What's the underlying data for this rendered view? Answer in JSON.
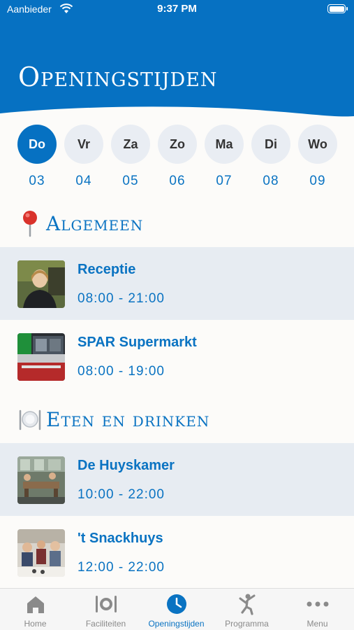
{
  "status_bar": {
    "carrier": "Aanbieder",
    "time": "9:37 PM"
  },
  "header": {
    "title": "Openingstijden"
  },
  "days": [
    {
      "label": "Do",
      "number": "03",
      "active": true
    },
    {
      "label": "Vr",
      "number": "04",
      "active": false
    },
    {
      "label": "Za",
      "number": "05",
      "active": false
    },
    {
      "label": "Zo",
      "number": "06",
      "active": false
    },
    {
      "label": "Ma",
      "number": "07",
      "active": false
    },
    {
      "label": "Di",
      "number": "08",
      "active": false
    },
    {
      "label": "Wo",
      "number": "09",
      "active": false
    }
  ],
  "sections": [
    {
      "title": "Algemeen",
      "icon": "pushpin-icon",
      "items": [
        {
          "name": "Receptie",
          "hours": "08:00 - 21:00"
        },
        {
          "name": "SPAR Supermarkt",
          "hours": "08:00 - 19:00"
        }
      ]
    },
    {
      "title": "Eten en drinken",
      "icon": "plate-cutlery-icon",
      "items": [
        {
          "name": "De Huyskamer",
          "hours": "10:00 - 22:00"
        },
        {
          "name": "'t Snackhuys",
          "hours": "12:00 - 22:00"
        }
      ]
    }
  ],
  "tabbar": {
    "items": [
      {
        "label": "Home",
        "icon": "home-icon",
        "active": false
      },
      {
        "label": "Faciliteiten",
        "icon": "cutlery-icon",
        "active": false
      },
      {
        "label": "Openingstijden",
        "icon": "clock-icon",
        "active": true
      },
      {
        "label": "Programma",
        "icon": "dancer-icon",
        "active": false
      },
      {
        "label": "Menu",
        "icon": "more-dots-icon",
        "active": false
      }
    ]
  },
  "colors": {
    "brand_blue": "#0671c2",
    "row_shade": "#e7ecf2",
    "inactive_gray": "#8a8a8a"
  }
}
